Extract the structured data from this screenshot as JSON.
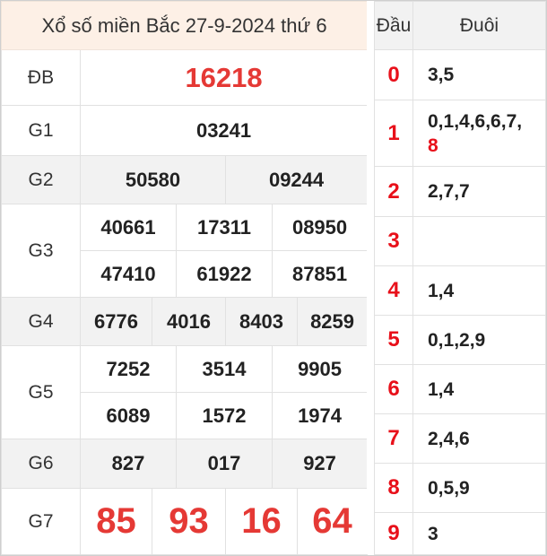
{
  "title": "Xổ số miền Bắc 27-9-2024 thứ 6",
  "prizes": {
    "db": {
      "label": "ĐB",
      "numbers": [
        "16218"
      ]
    },
    "g1": {
      "label": "G1",
      "numbers": [
        "03241"
      ]
    },
    "g2": {
      "label": "G2",
      "numbers": [
        "50580",
        "09244"
      ]
    },
    "g3": {
      "label": "G3",
      "numbers": [
        "40661",
        "17311",
        "08950",
        "47410",
        "61922",
        "87851"
      ]
    },
    "g4": {
      "label": "G4",
      "numbers": [
        "6776",
        "4016",
        "8403",
        "8259"
      ]
    },
    "g5": {
      "label": "G5",
      "numbers": [
        "7252",
        "3514",
        "9905",
        "6089",
        "1572",
        "1974"
      ]
    },
    "g6": {
      "label": "G6",
      "numbers": [
        "827",
        "017",
        "927"
      ]
    },
    "g7": {
      "label": "G7",
      "numbers": [
        "85",
        "93",
        "16",
        "64"
      ]
    }
  },
  "loto": {
    "head_label": "Đầu",
    "tail_label": "Đuôi",
    "rows": [
      {
        "head": "0",
        "tail": "3,5"
      },
      {
        "head": "1",
        "tail": "0,1,4,6,6,7,",
        "tail_highlight": "8"
      },
      {
        "head": "2",
        "tail": "2,7,7"
      },
      {
        "head": "3",
        "tail": ""
      },
      {
        "head": "4",
        "tail": "1,4"
      },
      {
        "head": "5",
        "tail": "0,1,2,9"
      },
      {
        "head": "6",
        "tail": "1,4"
      },
      {
        "head": "7",
        "tail": "2,4,6"
      },
      {
        "head": "8",
        "tail": "0,5,9"
      },
      {
        "head": "9",
        "tail": "3"
      }
    ]
  },
  "colors": {
    "accent_red": "#e53935",
    "head_red": "#e8101a",
    "title_bg": "#fdf0e6",
    "stripe_bg": "#f2f2f2"
  }
}
